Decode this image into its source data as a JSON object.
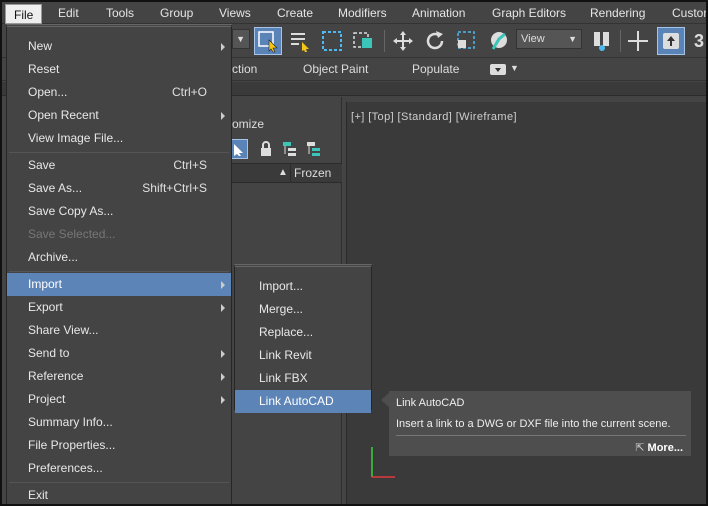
{
  "menubar": {
    "items": [
      "File",
      "Edit",
      "Tools",
      "Group",
      "Views",
      "Create",
      "Modifiers",
      "Animation",
      "Graph Editors",
      "Rendering",
      "Custor"
    ]
  },
  "toolbar": {
    "view_dropdown": "View",
    "partial_label": "3"
  },
  "ribbon": {
    "tabs": [
      "ction",
      "Object Paint",
      "Populate"
    ]
  },
  "scene_explorer": {
    "title": "omize",
    "column_frozen": "Frozen"
  },
  "viewport": {
    "label": "[+] [Top] [Standard] [Wireframe]"
  },
  "file_menu": {
    "items": [
      {
        "label": "New",
        "shortcut": "",
        "submenu": true
      },
      {
        "label": "Reset",
        "shortcut": "",
        "submenu": false
      },
      {
        "label": "Open...",
        "shortcut": "Ctrl+O",
        "submenu": false
      },
      {
        "label": "Open Recent",
        "shortcut": "",
        "submenu": true
      },
      {
        "label": "View Image File...",
        "shortcut": "",
        "submenu": false
      },
      {
        "label": "Save",
        "shortcut": "Ctrl+S",
        "submenu": false
      },
      {
        "label": "Save As...",
        "shortcut": "Shift+Ctrl+S",
        "submenu": false
      },
      {
        "label": "Save Copy As...",
        "shortcut": "",
        "submenu": false
      },
      {
        "label": "Save Selected...",
        "shortcut": "",
        "submenu": false,
        "disabled": true
      },
      {
        "label": "Archive...",
        "shortcut": "",
        "submenu": false
      },
      {
        "label": "Import",
        "shortcut": "",
        "submenu": true,
        "highlighted": true
      },
      {
        "label": "Export",
        "shortcut": "",
        "submenu": true
      },
      {
        "label": "Share View...",
        "shortcut": "",
        "submenu": false
      },
      {
        "label": "Send to",
        "shortcut": "",
        "submenu": true
      },
      {
        "label": "Reference",
        "shortcut": "",
        "submenu": true
      },
      {
        "label": "Project",
        "shortcut": "",
        "submenu": true
      },
      {
        "label": "Summary Info...",
        "shortcut": "",
        "submenu": false
      },
      {
        "label": "File Properties...",
        "shortcut": "",
        "submenu": false
      },
      {
        "label": "Preferences...",
        "shortcut": "",
        "submenu": false
      },
      {
        "label": "Exit",
        "shortcut": "",
        "submenu": false
      }
    ]
  },
  "import_submenu": {
    "items": [
      {
        "label": "Import..."
      },
      {
        "label": "Merge..."
      },
      {
        "label": "Replace..."
      },
      {
        "label": "Link Revit"
      },
      {
        "label": "Link FBX"
      },
      {
        "label": "Link AutoCAD",
        "highlighted": true
      }
    ]
  },
  "tooltip": {
    "title": "Link AutoCAD",
    "description": "Insert a link to a DWG or DXF file into the current scene.",
    "more": "More..."
  },
  "colors": {
    "highlight": "#5d84b7",
    "background": "#444444",
    "viewport": "#3a3a3a"
  }
}
